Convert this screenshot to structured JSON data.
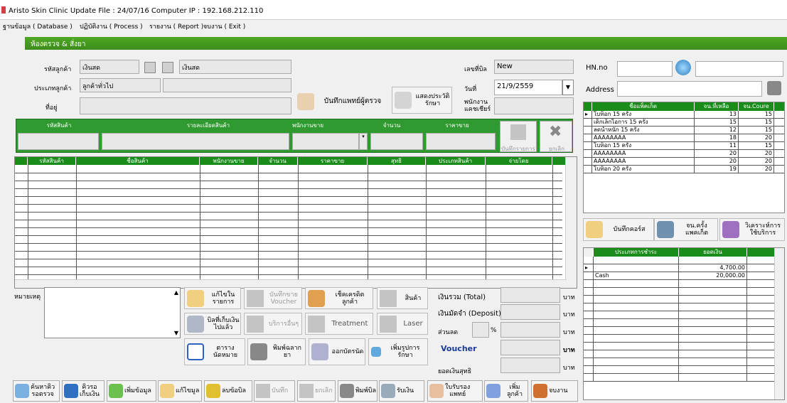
{
  "window": {
    "title": "Aristo Skin Clinic  Update File : 24/07/16 Computer  IP : 192.168.212.110"
  },
  "menu": [
    "ฐานข้อมูล ( Database )",
    "ปฏิบัติงาน ( Process )",
    "รายงาน ( Report )",
    "จบงาน ( Exit )"
  ],
  "form": {
    "title": "ห้องตรวจ & สั่งยา"
  },
  "customer": {
    "code_label": "รหัสลูกค้า",
    "code_value": "เงินสด",
    "name_value": "เงินสด",
    "type_label": "ประเภทลูกค้า",
    "type_value": "ลูกค้าทั่วไป",
    "addr_label": "ที่อยู่"
  },
  "doctor_btn": "บันทึกแพทย์ผู้ตรวจ",
  "history_btn": "แสดงประวัติ\nรักษา",
  "bill": {
    "no_label": "เลขที่บิล",
    "no_value": "New",
    "date_label": "วันที่",
    "date_value": "21/9/2559",
    "cashier_label": "พนักงาน\nแคชเชียร์"
  },
  "entry": {
    "cols": [
      "รหัสสินค้า",
      "รายละเอียดสินค้า",
      "พนักงานขาย",
      "จำนวน",
      "ราคาขาย"
    ],
    "save": "บันทึกรายการ",
    "cancel": "ยกเลิก"
  },
  "grid": {
    "cols": [
      "รหัสสินค้า",
      "ชื่อสินค้า",
      "พนักงานขาย",
      "จำนวน",
      "ราคาขาย",
      "สุทธิ",
      "ประเภทสินค้า",
      "จ่ายโดย"
    ]
  },
  "remark_label": "หมายเหตุ",
  "actions": {
    "edit": "แก้ไขใน\nรายการ",
    "voucher": "บันทึกขาย\nVoucher",
    "credit": "เช็คเครดิต\nลูกค้า",
    "product": "สินค้า",
    "unpaid": "บิลที่เก็บเงิน\nไปแล้ว",
    "other": "บริการอื่นๆ",
    "treatment": "Treatment",
    "laser": "Laser",
    "appointment": "ตาราง\nนัดหมาย",
    "print_label": "พิมพ์ฉลากยา",
    "card": "ออกบัตรนัด",
    "add_service": "เพิ่มรูปการ\nรักษา"
  },
  "totals": {
    "total": "เงินรวม (Total)",
    "deposit": "เงินมัดจำ (Deposit)",
    "discount": "ส่วนลด",
    "pct": "%",
    "voucher": "Voucher",
    "net": "ยอดเงินสุทธิ",
    "unit": "บาท"
  },
  "right": {
    "hn_label": "HN.no",
    "addr_label": "Address",
    "pkg_cols": [
      "ชื่อแพ็คเก็ต",
      "จน.ที่เหลือ",
      "จน.Coure"
    ],
    "packages": [
      [
        "โบท็อก 15 ครั้ง",
        "13",
        "15"
      ],
      [
        "เด็กเล็กไอการ 15 ครั้ง",
        "15",
        "15"
      ],
      [
        "ลดน้ำหนัก 15 ครั้ง",
        "12",
        "15"
      ],
      [
        "AAAAAAAA",
        "18",
        "20"
      ],
      [
        "โบท็อก 15 ครั้ง",
        "11",
        "15"
      ],
      [
        "AAAAAAAA",
        "20",
        "20"
      ],
      [
        "AAAAAAAA",
        "20",
        "20"
      ],
      [
        "โบท็อก 20 ครั้ง",
        "19",
        "20"
      ]
    ],
    "course_btn": "บันทึกคอร์ส",
    "count_btn": "จน.ครั้ง\nแพคเก็ต",
    "method_btn": "วิเคราะห์การ\nใช้บริการ",
    "pay_cols": [
      "ประเภทการชำระ",
      "ยอดเงิน"
    ],
    "payments": [
      [
        "",
        "4,700.00"
      ],
      [
        "Cash",
        "20,000.00"
      ]
    ]
  },
  "bottom": [
    "ค้นหาคิว\nรอตรวจ",
    "คิวรอ\nเก็บเงิน",
    "เพิ่มข้อมูล",
    "แก้ไขมูล",
    "ลบข้อบิล",
    "บันทึก",
    "ยกเลิก",
    "พิมพ์บิล",
    "รับเงิน",
    "ใบรับรอง\nแพทย์",
    "เพิ่มลูกค้า",
    "จบงาน"
  ]
}
